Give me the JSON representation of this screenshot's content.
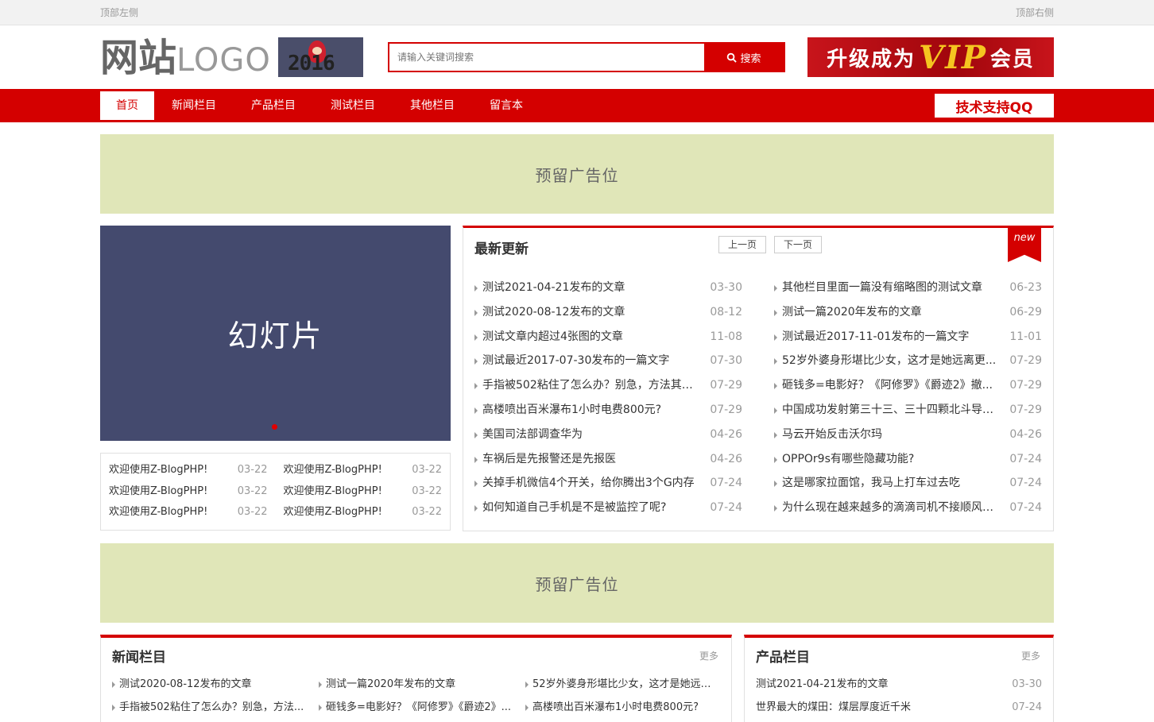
{
  "topbar": {
    "left": "顶部左侧",
    "right": "顶部右侧"
  },
  "header": {
    "logo_bold": "网站",
    "logo_light": "LOGO",
    "logo_year": "2016",
    "search_placeholder": "请输入关键词搜索",
    "search_button": "搜索",
    "vip_prefix": "升级成为",
    "vip_mid": "VIP",
    "vip_suffix": "会员"
  },
  "nav": {
    "items": [
      "首页",
      "新闻栏目",
      "产品栏目",
      "测试栏目",
      "其他栏目",
      "留言本"
    ],
    "qq": "技术支持QQ"
  },
  "ads": {
    "top": "预留广告位",
    "middle": "预留广告位"
  },
  "slide": {
    "label": "幻灯片"
  },
  "welcome": [
    {
      "title": "欢迎使用Z-BlogPHP!",
      "date": "03-22"
    },
    {
      "title": "欢迎使用Z-BlogPHP!",
      "date": "03-22"
    },
    {
      "title": "欢迎使用Z-BlogPHP!",
      "date": "03-22"
    },
    {
      "title": "欢迎使用Z-BlogPHP!",
      "date": "03-22"
    },
    {
      "title": "欢迎使用Z-BlogPHP!",
      "date": "03-22"
    },
    {
      "title": "欢迎使用Z-BlogPHP!",
      "date": "03-22"
    }
  ],
  "latest": {
    "title": "最新更新",
    "prev": "上一页",
    "next": "下一页",
    "badge": "new",
    "left": [
      {
        "title": "测试2021-04-21发布的文章",
        "date": "03-30"
      },
      {
        "title": "测试2020-08-12发布的文章",
        "date": "08-12"
      },
      {
        "title": "测试文章内超过4张图的文章",
        "date": "11-08"
      },
      {
        "title": "测试最近2017-07-30发布的一篇文字",
        "date": "07-30"
      },
      {
        "title": "手指被502粘住了怎么办？别急，方法其实...",
        "date": "07-29"
      },
      {
        "title": "高楼喷出百米瀑布1小时电费800元?",
        "date": "07-29"
      },
      {
        "title": "美国司法部调查华为",
        "date": "04-26"
      },
      {
        "title": "车祸后是先报警还是先报医",
        "date": "04-26"
      },
      {
        "title": "关掉手机微信4个开关，给你腾出3个G内存",
        "date": "07-24"
      },
      {
        "title": "如何知道自己手机是不是被监控了呢?",
        "date": "07-24"
      }
    ],
    "right": [
      {
        "title": "其他栏目里面一篇没有缩略图的测试文章",
        "date": "06-23"
      },
      {
        "title": "测试一篇2020年发布的文章",
        "date": "06-29"
      },
      {
        "title": "测试最近2017-11-01发布的一篇文字",
        "date": "11-01"
      },
      {
        "title": "52岁外婆身形堪比少女，这才是她远离更...",
        "date": "07-29"
      },
      {
        "title": "砸钱多=电影好？《阿修罗》《爵迹2》撤...",
        "date": "07-29"
      },
      {
        "title": "中国成功发射第三十三、三十四颗北斗导航...",
        "date": "07-29"
      },
      {
        "title": "马云开始反击沃尔玛",
        "date": "04-26"
      },
      {
        "title": "OPPOr9s有哪些隐藏功能?",
        "date": "07-24"
      },
      {
        "title": "这是哪家拉面馆，我马上打车过去吃",
        "date": "07-24"
      },
      {
        "title": "为什么现在越来越多的滴滴司机不接顺风车...",
        "date": "07-24"
      }
    ]
  },
  "news_box": {
    "title": "新闻栏目",
    "more": "更多",
    "items": [
      "测试2020-08-12发布的文章",
      "测试一篇2020年发布的文章",
      "52岁外婆身形堪比少女，这才是她远离...",
      "手指被502粘住了怎么办？别急，方法...",
      "砸钱多=电影好？《阿修罗》《爵迹2》...",
      "高楼喷出百米瀑布1小时电费800元?"
    ]
  },
  "prod_box": {
    "title": "产品栏目",
    "more": "更多",
    "items": [
      {
        "title": "测试2021-04-21发布的文章",
        "date": "03-30"
      },
      {
        "title": "世界最大的煤田：煤层厚度近千米",
        "date": "07-24"
      }
    ]
  }
}
